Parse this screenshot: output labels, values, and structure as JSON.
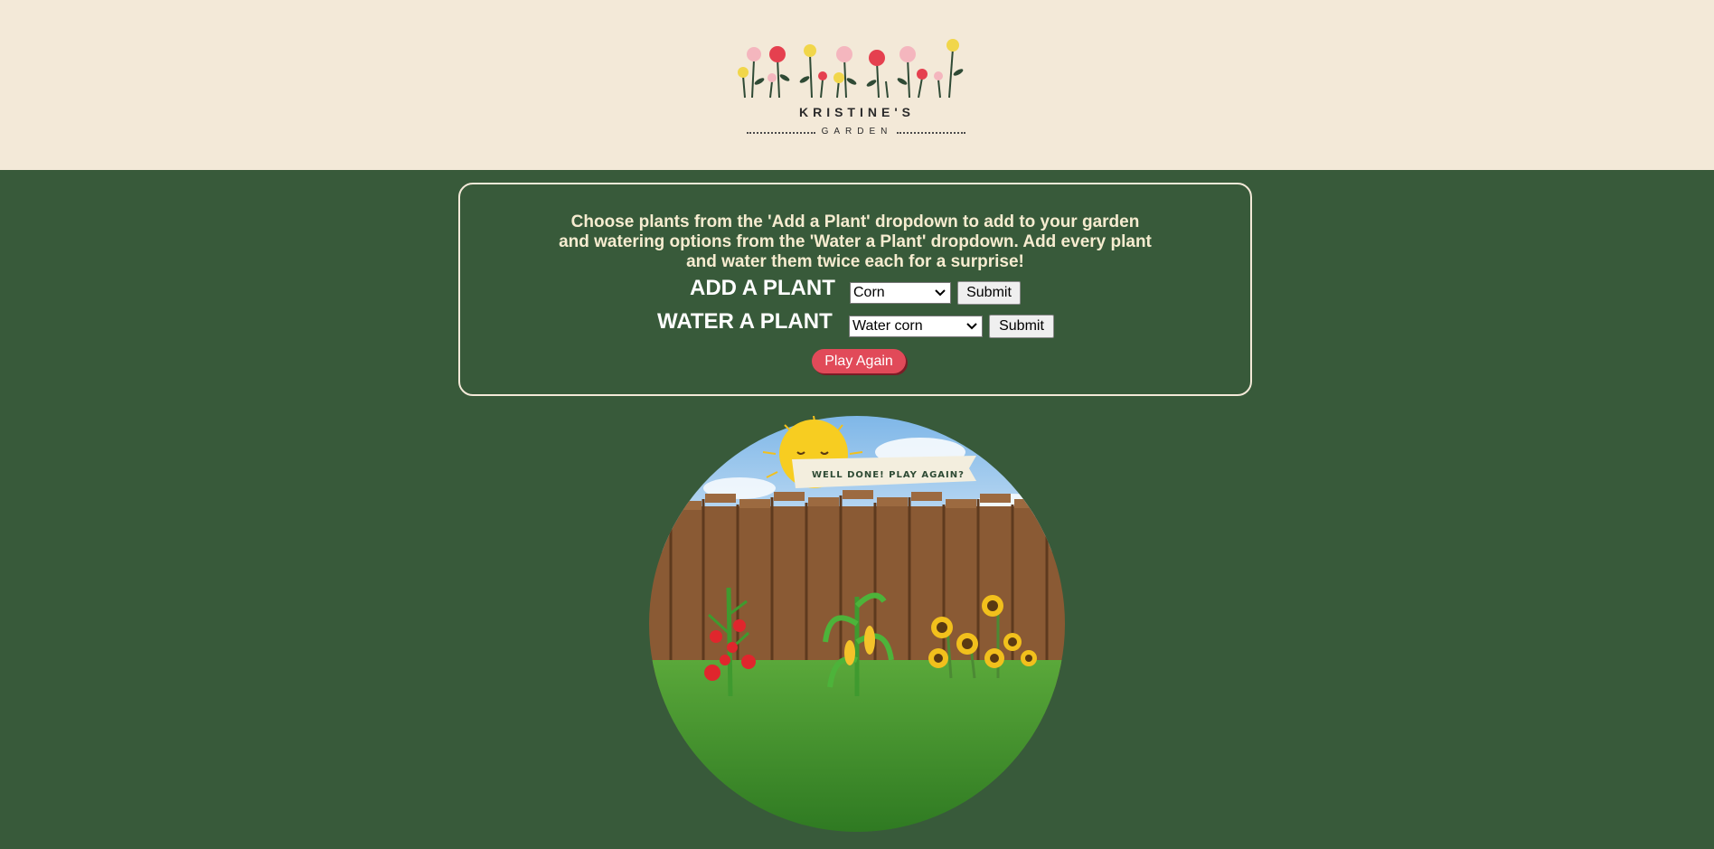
{
  "logo": {
    "title": "KRISTINE'S",
    "subtitle": "GARDEN"
  },
  "instructions": {
    "line1": "Choose plants from the 'Add a Plant' dropdown to add to your garden",
    "line2": "and watering options from the 'Water a Plant' dropdown. Add every plant",
    "line3": "and water them twice each for a surprise!"
  },
  "add_plant": {
    "label": "ADD A PLANT",
    "selected": "Corn",
    "submit_label": "Submit"
  },
  "water_plant": {
    "label": "WATER A PLANT",
    "selected": "Water corn",
    "submit_label": "Submit"
  },
  "play_again_label": "Play Again",
  "garden_image": {
    "banner_text": "WELL DONE! PLAY AGAIN?"
  },
  "colors": {
    "header_bg": "#f3e9d8",
    "page_bg": "#385a3a",
    "accent": "#e14a59",
    "instruction_text": "#f6ecd0"
  },
  "icons": [
    "flower-icon",
    "chevron-down-icon",
    "sun-icon",
    "tomato-plant-icon",
    "corn-plant-icon",
    "sunflower-icon"
  ]
}
